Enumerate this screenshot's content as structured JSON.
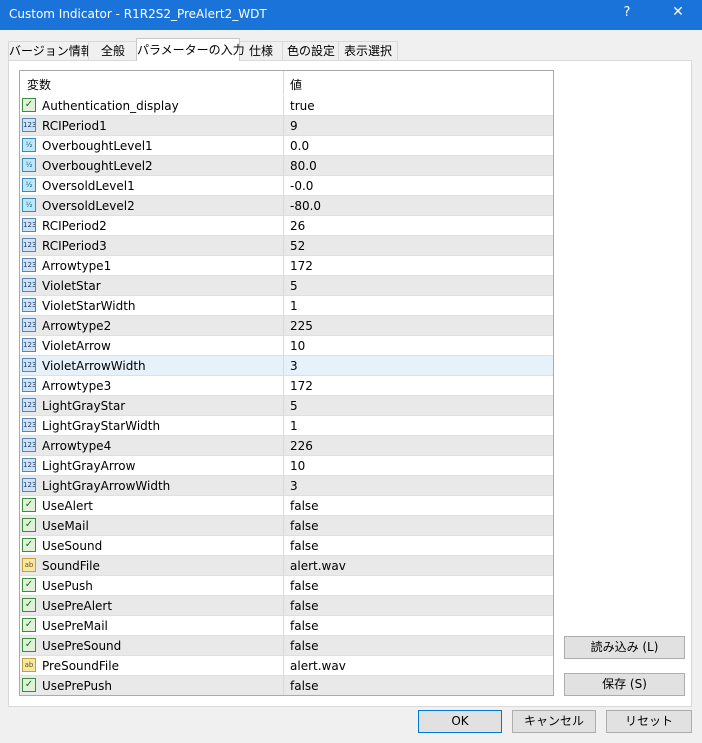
{
  "window": {
    "title": "Custom Indicator - R1R2S2_PreAlert2_WDT",
    "help": "?",
    "close": "✕"
  },
  "tabs": [
    {
      "label": "バージョン情報"
    },
    {
      "label": "全般"
    },
    {
      "label": "パラメーターの入力",
      "active": true
    },
    {
      "label": "仕様"
    },
    {
      "label": "色の設定"
    },
    {
      "label": "表示選択"
    }
  ],
  "grid": {
    "col_variable": "変数",
    "col_value": "値",
    "selected_index": 13,
    "rows": [
      {
        "name": "Authentication_display",
        "value": "true",
        "type": "bool"
      },
      {
        "name": "RCIPeriod1",
        "value": "9",
        "type": "int"
      },
      {
        "name": "OverboughtLevel1",
        "value": "0.0",
        "type": "double"
      },
      {
        "name": "OverboughtLevel2",
        "value": "80.0",
        "type": "double"
      },
      {
        "name": "OversoldLevel1",
        "value": "-0.0",
        "type": "double"
      },
      {
        "name": "OversoldLevel2",
        "value": "-80.0",
        "type": "double"
      },
      {
        "name": "RCIPeriod2",
        "value": "26",
        "type": "int"
      },
      {
        "name": "RCIPeriod3",
        "value": "52",
        "type": "int"
      },
      {
        "name": "Arrowtype1",
        "value": "172",
        "type": "int"
      },
      {
        "name": "VioletStar",
        "value": "5",
        "type": "int"
      },
      {
        "name": "VioletStarWidth",
        "value": "1",
        "type": "int"
      },
      {
        "name": "Arrowtype2",
        "value": "225",
        "type": "int"
      },
      {
        "name": "VioletArrow",
        "value": "10",
        "type": "int"
      },
      {
        "name": "VioletArrowWidth",
        "value": "3",
        "type": "int"
      },
      {
        "name": "Arrowtype3",
        "value": "172",
        "type": "int"
      },
      {
        "name": "LightGrayStar",
        "value": "5",
        "type": "int"
      },
      {
        "name": "LightGrayStarWidth",
        "value": "1",
        "type": "int"
      },
      {
        "name": "Arrowtype4",
        "value": "226",
        "type": "int"
      },
      {
        "name": "LightGrayArrow",
        "value": "10",
        "type": "int"
      },
      {
        "name": "LightGrayArrowWidth",
        "value": "3",
        "type": "int"
      },
      {
        "name": "UseAlert",
        "value": "false",
        "type": "bool"
      },
      {
        "name": "UseMail",
        "value": "false",
        "type": "bool"
      },
      {
        "name": "UseSound",
        "value": "false",
        "type": "bool"
      },
      {
        "name": "SoundFile",
        "value": "alert.wav",
        "type": "string"
      },
      {
        "name": "UsePush",
        "value": "false",
        "type": "bool"
      },
      {
        "name": "UsePreAlert",
        "value": "false",
        "type": "bool"
      },
      {
        "name": "UsePreMail",
        "value": "false",
        "type": "bool"
      },
      {
        "name": "UsePreSound",
        "value": "false",
        "type": "bool"
      },
      {
        "name": "PreSoundFile",
        "value": "alert.wav",
        "type": "string"
      },
      {
        "name": "UsePrePush",
        "value": "false",
        "type": "bool"
      }
    ]
  },
  "type_icons": {
    "int": "123",
    "double": "½",
    "bool": "✓",
    "string": "ab"
  },
  "buttons": {
    "load": "読み込み (L)",
    "save": "保存 (S)",
    "ok": "OK",
    "cancel": "キャンセル",
    "reset": "リセット"
  },
  "colors": {
    "titlebar": "#1a73d9",
    "selected_row": "#e6f1fa",
    "alt_row": "#e9e9e9"
  }
}
